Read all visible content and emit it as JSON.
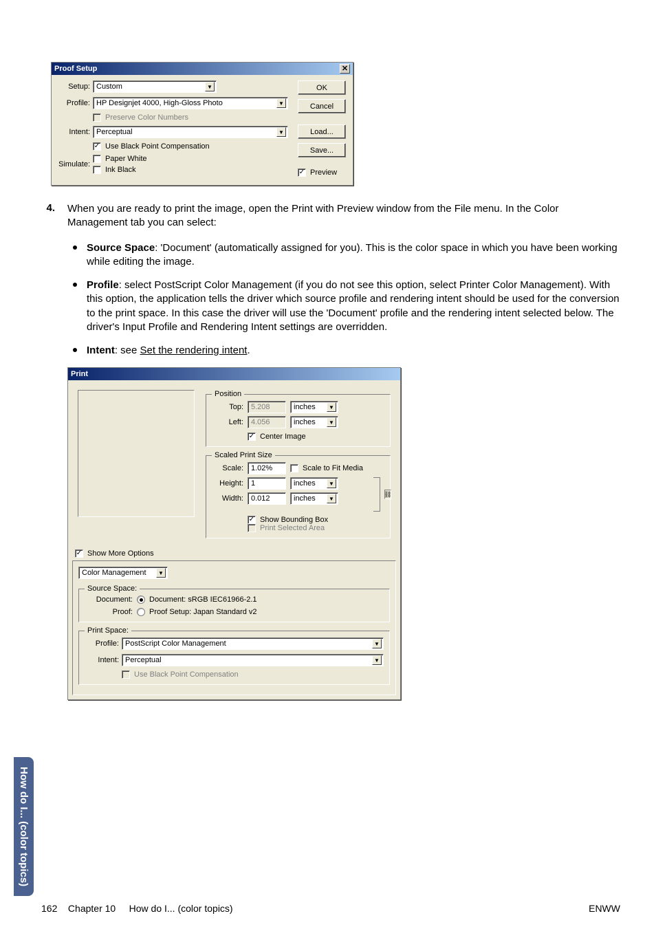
{
  "proof_setup": {
    "title": "Proof Setup",
    "labels": {
      "setup": "Setup:",
      "profile": "Profile:",
      "intent": "Intent:",
      "simulate": "Simulate:"
    },
    "setup_value": "Custom",
    "profile_value": "HP Designjet 4000, High-Gloss Photo",
    "preserve": "Preserve Color Numbers",
    "intent_value": "Perceptual",
    "use_bpc": "Use Black Point Compensation",
    "paper_white": "Paper White",
    "ink_black": "Ink Black",
    "buttons": {
      "ok": "OK",
      "cancel": "Cancel",
      "load": "Load...",
      "save": "Save..."
    },
    "preview": "Preview"
  },
  "step4": {
    "num": "4.",
    "text": "When you are ready to print the image, open the Print with Preview window from the File menu. In the Color Management tab you can select:",
    "b1_label": "Source Space",
    "b1_text": ": 'Document' (automatically assigned for you). This is the color space in which you have been working while editing the image.",
    "b2_label": "Profile",
    "b2_text": ": select PostScript Color Management (if you do not see this option, select Printer Color Management). With this option, the application tells the driver which source profile and rendering intent should be used for the conversion to the print space. In this case the driver will use the 'Document' profile and the rendering intent selected below. The driver's Input Profile and Rendering Intent settings are overridden.",
    "b3_label": "Intent",
    "b3_text": ": see ",
    "b3_link": "Set the rendering intent",
    "b3_tail": "."
  },
  "print": {
    "title": "Print",
    "position": {
      "legend": "Position",
      "top_lbl": "Top:",
      "top_val": "5.208",
      "left_lbl": "Left:",
      "left_val": "4.056",
      "unit": "inches",
      "center": "Center Image"
    },
    "scaled": {
      "legend": "Scaled Print Size",
      "scale_lbl": "Scale:",
      "scale_val": "1.02%",
      "fit": "Scale to Fit Media",
      "height_lbl": "Height:",
      "height_val": "1",
      "width_lbl": "Width:",
      "width_val": "0.012",
      "unit": "inches",
      "show_bb": "Show Bounding Box",
      "print_sel": "Print Selected Area"
    },
    "show_more": "Show More Options",
    "cm_tab": "Color Management",
    "source_space": {
      "legend": "Source Space:",
      "document_lbl": "Document:",
      "document_radio": "Document:  sRGB IEC61966-2.1",
      "proof_lbl": "Proof:",
      "proof_radio": "Proof Setup:  Japan Standard v2"
    },
    "print_space": {
      "legend": "Print Space:",
      "profile_lbl": "Profile:",
      "profile_val": "PostScript Color Management",
      "intent_lbl": "Intent:",
      "intent_val": "Perceptual",
      "use_bpc": "Use Black Point Compensation"
    }
  },
  "sidetab": "How do I... (color topics)",
  "footer": {
    "page": "162",
    "chapter": "Chapter 10",
    "title": "How do I... (color topics)",
    "right": "ENWW"
  }
}
